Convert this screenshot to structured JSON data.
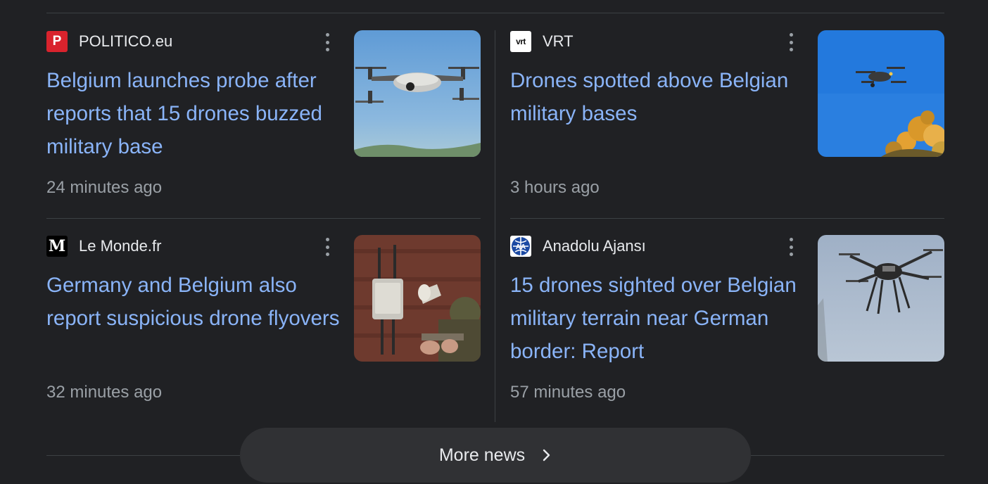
{
  "articles": [
    {
      "source": "POLITICO.eu",
      "logo": "P",
      "headline": "Belgium launches probe after reports that 15 drones buzzed military base",
      "time": "24 minutes ago"
    },
    {
      "source": "VRT",
      "logo": "vrt",
      "headline": "Drones spotted above Belgian military bases",
      "time": "3 hours ago"
    },
    {
      "source": "Le Monde.fr",
      "logo": "M",
      "headline": "Germany and Belgium also report suspicious drone flyovers",
      "time": "32 minutes ago"
    },
    {
      "source": "Anadolu Ajansı",
      "logo": "AA",
      "headline": "15 drones sighted over Belgian military terrain near German border: Report",
      "time": "57 minutes ago"
    }
  ],
  "more_news": {
    "label": "More news"
  },
  "colors": {
    "background": "#202124",
    "link": "#8ab4f8",
    "muted": "#9aa0a6",
    "divider": "#3c4043"
  },
  "icons": {
    "more_options": "kebab-vertical-icon",
    "chevron": "chevron-right-icon"
  }
}
